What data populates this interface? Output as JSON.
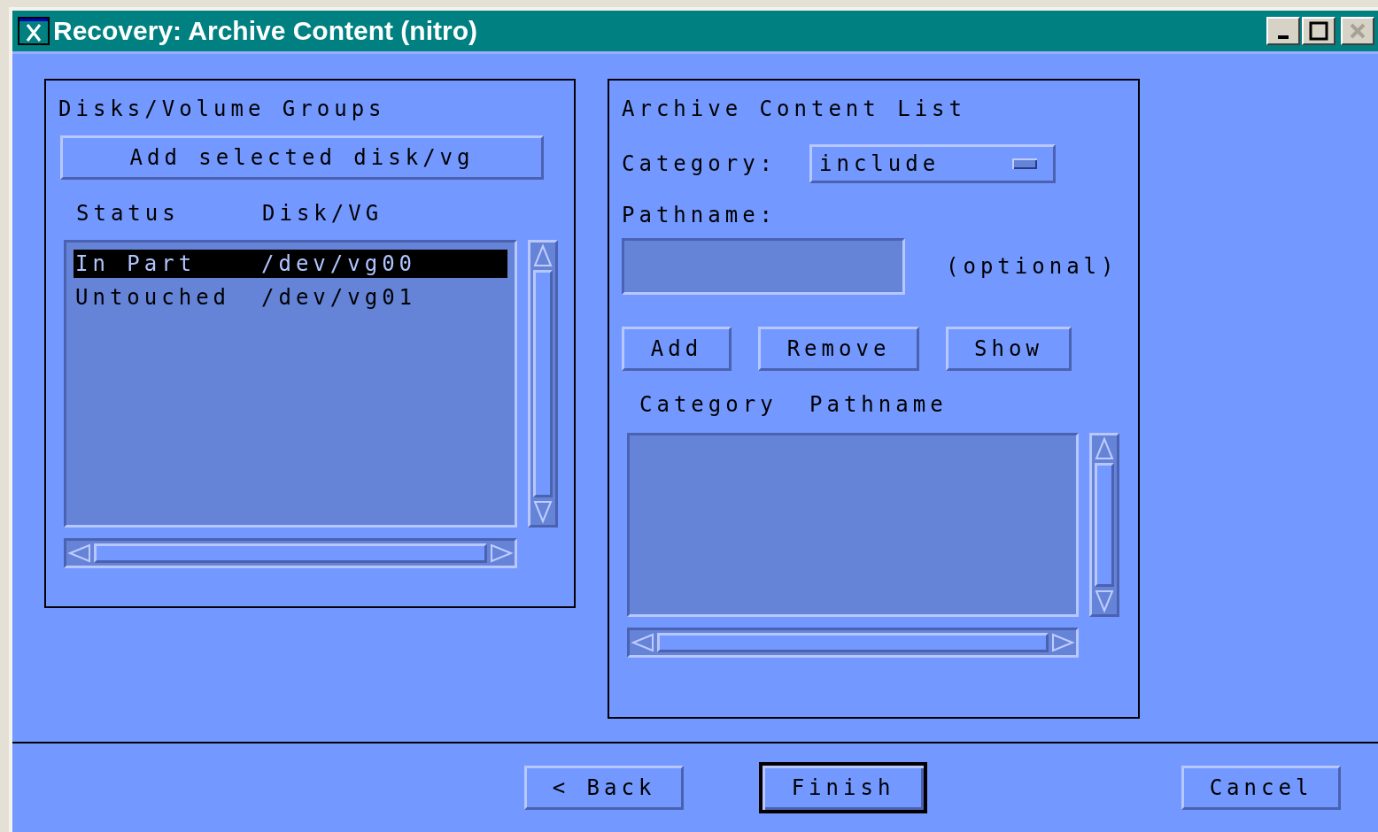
{
  "window": {
    "title": "Recovery: Archive Content (nitro)"
  },
  "disks_panel": {
    "title": "Disks/Volume Groups",
    "add_button": "Add selected disk/vg",
    "columns": [
      "Status",
      "Disk/VG"
    ],
    "rows": [
      {
        "status": "In Part",
        "disk": "/dev/vg00",
        "selected": true
      },
      {
        "status": "Untouched",
        "disk": "/dev/vg01",
        "selected": false
      }
    ]
  },
  "content_panel": {
    "title": "Archive Content List",
    "category_label": "Category:",
    "category_value": "include",
    "pathname_label": "Pathname:",
    "pathname_note": "(optional)",
    "buttons": [
      "Add",
      "Remove",
      "Show"
    ],
    "columns": [
      "Category",
      "Pathname"
    ]
  },
  "footer": {
    "buttons": [
      {
        "label": "< Back",
        "default": false
      },
      {
        "label": "Finish",
        "default": true
      },
      {
        "label": "Cancel",
        "default": false
      }
    ]
  }
}
